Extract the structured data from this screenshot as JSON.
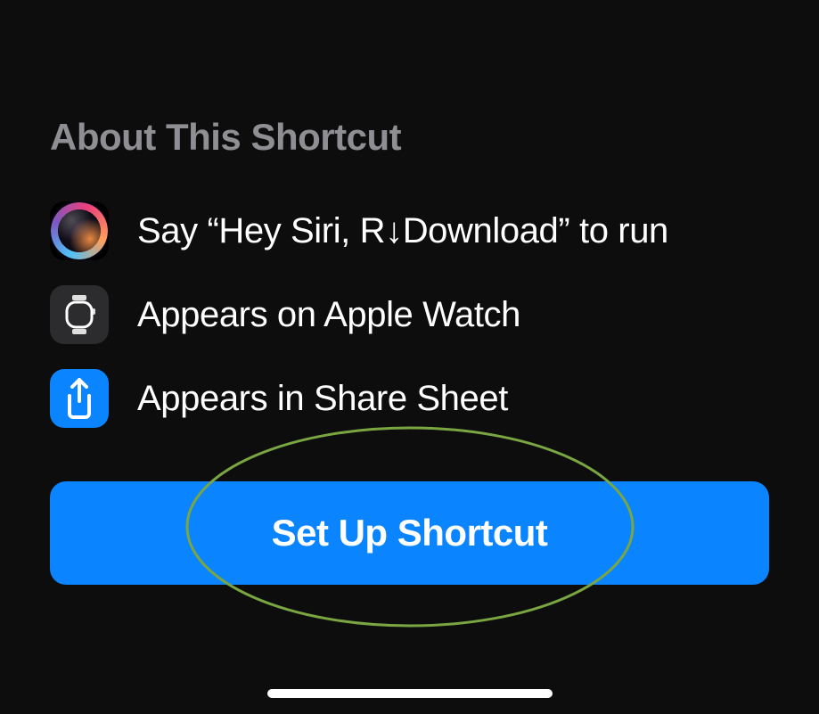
{
  "section": {
    "title": "About This Shortcut"
  },
  "items": {
    "siri": {
      "text": "Say “Hey Siri, R↓Download” to run"
    },
    "watch": {
      "text": "Appears on Apple Watch"
    },
    "share": {
      "text": "Appears in Share Sheet"
    }
  },
  "button": {
    "setup_label": "Set Up Shortcut"
  },
  "colors": {
    "accent": "#0a84ff",
    "annotation": "#7aa642"
  }
}
